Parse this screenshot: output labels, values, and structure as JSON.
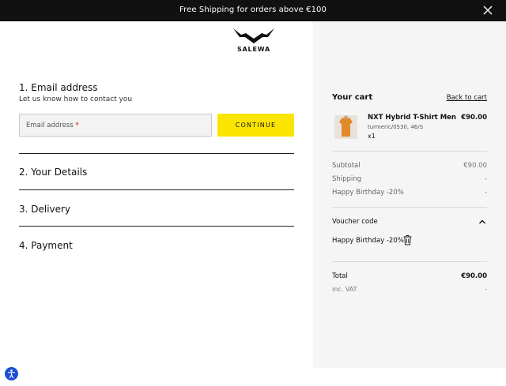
{
  "banner": {
    "message": "Free Shipping for orders above €100"
  },
  "brand": {
    "logo_text": "SALEWA"
  },
  "checkout": {
    "email_step": {
      "title": "1. Email address",
      "subtitle": "Let us know how to contact you",
      "email_placeholder": "Email address",
      "required_marker": "*",
      "continue_label": "CONTINUE"
    },
    "steps": [
      {
        "title": "2. Your Details"
      },
      {
        "title": "3. Delivery"
      },
      {
        "title": "4. Payment"
      }
    ]
  },
  "cart": {
    "title": "Your cart",
    "back_label": "Back to cart",
    "item": {
      "name": "NXT Hybrid T-Shirt Men",
      "variant": "turmeric/0530, 46/S",
      "quantity": "x1",
      "price": "€90.00",
      "image_color": "#e08a2a"
    },
    "subtotal": {
      "label": "Subtotal",
      "value": "€90.00"
    },
    "shipping": {
      "label": "Shipping",
      "value": "-"
    },
    "discount": {
      "label": "Happy Birthday -20%",
      "value": "-"
    },
    "voucher": {
      "label": "Voucher code",
      "applied_code": "Happy Birthday -20%"
    },
    "total": {
      "label": "Total",
      "value": "€90.00"
    },
    "vat": {
      "label": "inc. VAT",
      "value": "-"
    }
  },
  "colors": {
    "accent": "#fbe400",
    "topbar": "#111111",
    "sidebar": "#f5f5f5",
    "a11y": "#1c4fd6"
  }
}
